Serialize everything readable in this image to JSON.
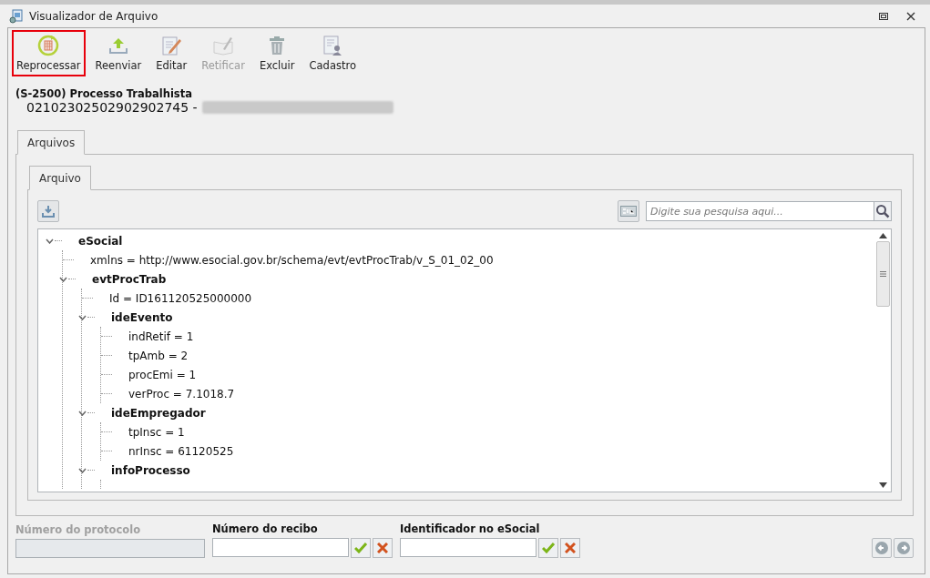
{
  "window": {
    "title": "Visualizador de Arquivo"
  },
  "toolbar": [
    {
      "label": "Reprocessar",
      "kind": "reprocess",
      "selected": true,
      "disabled": false
    },
    {
      "label": "Reenviar",
      "kind": "upload",
      "selected": false,
      "disabled": false
    },
    {
      "label": "Editar",
      "kind": "edit",
      "selected": false,
      "disabled": false
    },
    {
      "label": "Retificar",
      "kind": "rectify",
      "selected": false,
      "disabled": true
    },
    {
      "label": "Excluir",
      "kind": "delete",
      "selected": false,
      "disabled": false
    },
    {
      "label": "Cadastro",
      "kind": "register",
      "selected": false,
      "disabled": false
    }
  ],
  "header": {
    "title": "(S-2500) Processo Trabalhista",
    "number": "02102302502902902745 -"
  },
  "outer_tabs": [
    {
      "label": "Arquivos",
      "selected": true
    }
  ],
  "inner_tabs": [
    {
      "label": "Arquivo",
      "selected": true
    }
  ],
  "search": {
    "placeholder": "Digite sua pesquisa aqui..."
  },
  "tree": [
    {
      "kind": "element",
      "label": "eSocial",
      "expanded": true,
      "children": [
        {
          "kind": "attribute",
          "label": "xmlns = http://www.esocial.gov.br/schema/evt/evtProcTrab/v_S_01_02_00"
        },
        {
          "kind": "element",
          "label": "evtProcTrab",
          "expanded": true,
          "children": [
            {
              "kind": "attribute",
              "label": "Id = ID161120525000000"
            },
            {
              "kind": "element",
              "label": "ideEvento",
              "expanded": true,
              "children": [
                {
                  "kind": "attribute",
                  "label": "indRetif = 1"
                },
                {
                  "kind": "attribute",
                  "label": "tpAmb = 2"
                },
                {
                  "kind": "attribute",
                  "label": "procEmi = 1"
                },
                {
                  "kind": "attribute",
                  "label": "verProc = 7.1018.7"
                }
              ]
            },
            {
              "kind": "element",
              "label": "ideEmpregador",
              "expanded": true,
              "children": [
                {
                  "kind": "attribute",
                  "label": "tpInsc = 1"
                },
                {
                  "kind": "attribute",
                  "label": "nrInsc = 61120525"
                }
              ]
            },
            {
              "kind": "element",
              "label": "infoProcesso",
              "expanded": true
            }
          ]
        }
      ]
    }
  ],
  "fields": [
    {
      "label": "Número do protocolo",
      "disabled": true,
      "actions": false
    },
    {
      "label": "Número do recibo",
      "disabled": false,
      "actions": true
    },
    {
      "label": "Identificador no eSocial",
      "disabled": false,
      "actions": true
    }
  ]
}
